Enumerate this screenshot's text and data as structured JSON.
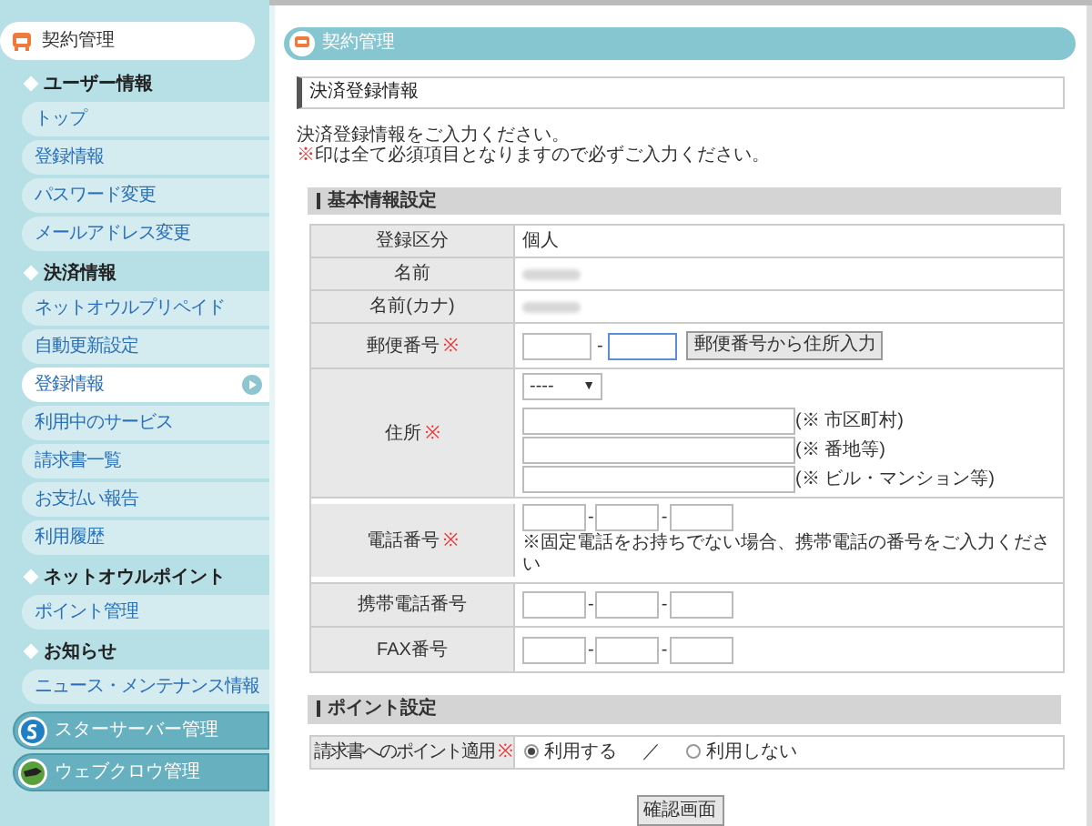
{
  "sidebar": {
    "header": {
      "label": "契約管理"
    },
    "sections": [
      {
        "title": "ユーザー情報",
        "items": [
          {
            "label": "トップ",
            "selected": false
          },
          {
            "label": "登録情報",
            "selected": false
          },
          {
            "label": "パスワード変更",
            "selected": false
          },
          {
            "label": "メールアドレス変更",
            "selected": false
          }
        ]
      },
      {
        "title": "決済情報",
        "items": [
          {
            "label": "ネットオウルプリペイド",
            "selected": false
          },
          {
            "label": "自動更新設定",
            "selected": false
          },
          {
            "label": "登録情報",
            "selected": true
          },
          {
            "label": "利用中のサービス",
            "selected": false
          },
          {
            "label": "請求書一覧",
            "selected": false
          },
          {
            "label": "お支払い報告",
            "selected": false
          },
          {
            "label": "利用履歴",
            "selected": false
          }
        ]
      },
      {
        "title": "ネットオウルポイント",
        "items": [
          {
            "label": "ポイント管理",
            "selected": false
          }
        ]
      },
      {
        "title": "お知らせ",
        "items": [
          {
            "label": "ニュース・メンテナンス情報",
            "selected": false
          }
        ]
      }
    ],
    "services": [
      {
        "label": "スターサーバー管理",
        "kind": "star"
      },
      {
        "label": "ウェブクロウ管理",
        "kind": "crow"
      }
    ]
  },
  "main": {
    "header": "契約管理",
    "section_title": "決済登録情報",
    "intro": "決済登録情報をご入力ください。",
    "note": {
      "mark": "※",
      "text": "印は全て必須項目となりますので必ずご入力ください。"
    },
    "basic": {
      "title": "基本情報設定",
      "rows": [
        {
          "kind": "text",
          "label": "登録区分",
          "required": false,
          "value": "個人"
        },
        {
          "kind": "blurred",
          "label": "名前",
          "required": false
        },
        {
          "kind": "blurred",
          "label": "名前(カナ)",
          "required": false
        },
        {
          "kind": "postal",
          "label": "郵便番号",
          "required": true,
          "inputs": [
            {
              "focused": false
            },
            {
              "focused": true
            }
          ],
          "separator": "-",
          "button": "郵便番号から住所入力"
        },
        {
          "kind": "address",
          "label": "住所",
          "required": true,
          "select": "----",
          "caret": "▼",
          "lines": [
            {
              "hint": "(※ 市区町村)"
            },
            {
              "hint": "(※ 番地等)"
            },
            {
              "hint": "(※ ビル・マンション等)"
            }
          ]
        },
        {
          "kind": "phone",
          "label": "電話番号",
          "required": true,
          "separators": [
            "-",
            "-"
          ],
          "note": "※固定電話をお持ちでない場合、携帯電話の番号をご入力ください"
        },
        {
          "kind": "phone",
          "label": "携帯電話番号",
          "required": false,
          "separators": [
            "-",
            "-"
          ]
        },
        {
          "kind": "phone",
          "label": "FAX番号",
          "required": false,
          "separators": [
            "-",
            "-"
          ]
        }
      ]
    },
    "points": {
      "title": "ポイント設定",
      "label": "請求書へのポイント適用",
      "required": true,
      "options": [
        {
          "label": "利用する",
          "selected": true
        },
        {
          "label": "利用しない",
          "selected": false
        }
      ],
      "divider": "／"
    },
    "confirm_button": "確認画面"
  }
}
